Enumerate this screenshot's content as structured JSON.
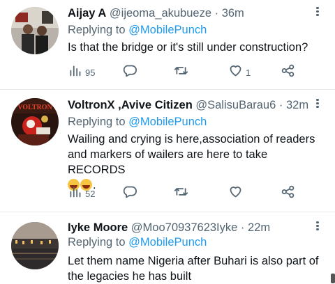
{
  "tweets": [
    {
      "name": "Aijay A",
      "handle": "@ijeoma_akubueze",
      "sep": "·",
      "time": "36m",
      "replying_prefix": "Replying to",
      "replying_to": "@MobilePunch",
      "text": "Is that the bridge or it's still under construction?",
      "views": "95",
      "likes": "1"
    },
    {
      "name": "VoltronX ,Avive Citizen",
      "handle": "@SalisuBarau6",
      "sep": "·",
      "time": "32m",
      "replying_prefix": "Replying to",
      "replying_to": "@MobilePunch",
      "text": "Wailing and crying is here,association of readers and markers of wailers are here to take RECORDS",
      "text_tail": ".",
      "emojis": [
        "rolling-on-floor-laughing",
        "face-with-tears-of-joy"
      ],
      "avatar_text": "VOLTRON",
      "views": "52",
      "likes": ""
    },
    {
      "name": "Iyke Moore",
      "handle": "@Moo70937623Iyke",
      "sep": "·",
      "time": "22m",
      "replying_prefix": "Replying to",
      "replying_to": "@MobilePunch",
      "text": "Let them name Nigeria after Buhari is also part of the legacies he has built"
    }
  ],
  "icons": [
    "views-icon",
    "reply-icon",
    "retweet-icon",
    "like-icon",
    "share-icon",
    "more-icon"
  ],
  "colors": {
    "link": "#1d9bf0",
    "muted": "#536471",
    "text": "#0f1419",
    "divider": "#e6e9ea"
  }
}
